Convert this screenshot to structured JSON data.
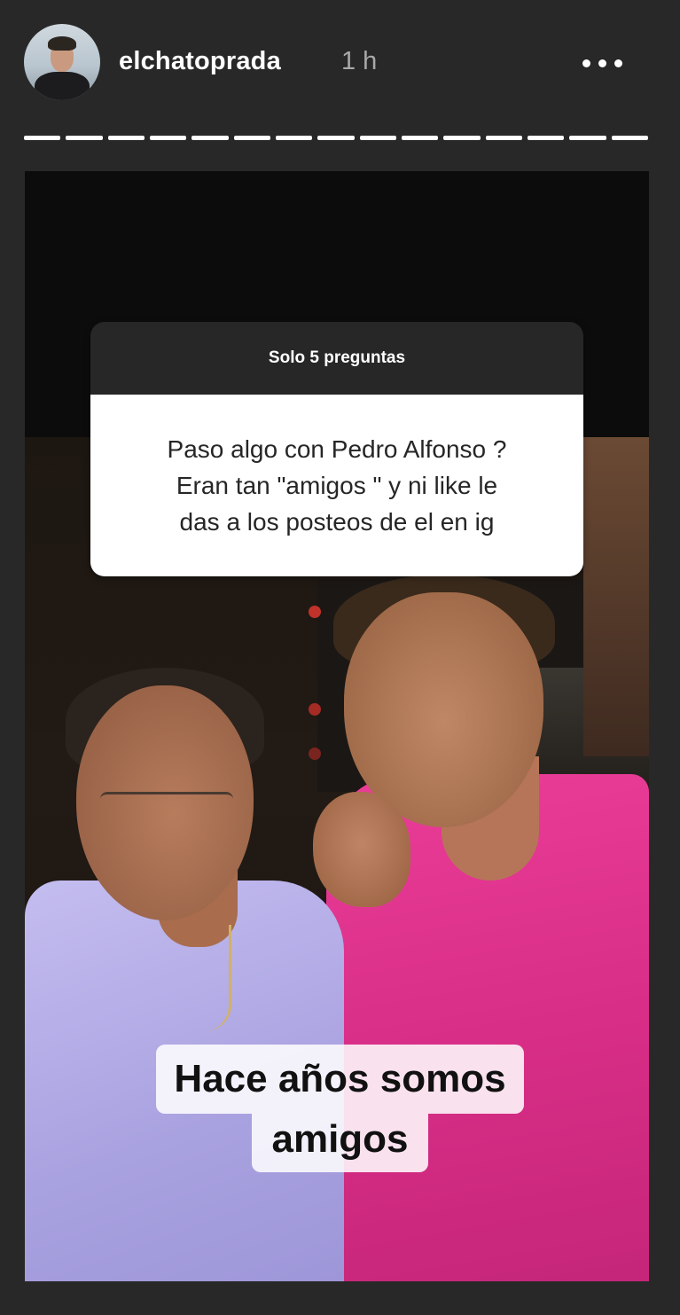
{
  "header": {
    "avatar_icon": "profile-avatar",
    "username": "elchatoprada",
    "time": "1 h",
    "more_icon": "more-options-icon"
  },
  "progress": {
    "segments": 15,
    "filled": 15,
    "color": "#ffffff"
  },
  "sticker": {
    "title": "Solo 5 preguntas",
    "question_lines": [
      "Paso algo con Pedro Alfonso ?",
      "Eran tan \"amigos \" y ni like le",
      "das a los posteos de el en ig"
    ]
  },
  "caption": {
    "lines": [
      "Hace años somos",
      "amigos"
    ]
  },
  "colors": {
    "background": "#282828",
    "left_shirt": "#b9b2ea",
    "right_shirt": "#e0358f"
  }
}
